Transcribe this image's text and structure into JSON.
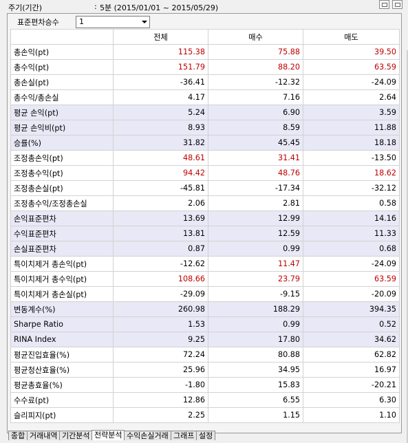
{
  "header": {
    "period_label": "주기(기간)",
    "period_colon": ":",
    "period_value": "5분 (2015/01/01 ~ 2015/05/29)"
  },
  "controls": {
    "std_label": "표준편차승수",
    "std_value": "1"
  },
  "table": {
    "columns": [
      "",
      "전체",
      "매수",
      "매도"
    ],
    "rows": [
      {
        "label": "총손익(pt)",
        "total": "115.38",
        "buy": "75.88",
        "sell": "39.50",
        "hl": false,
        "red": [
          true,
          true,
          true
        ]
      },
      {
        "label": "총수익(pt)",
        "total": "151.79",
        "buy": "88.20",
        "sell": "63.59",
        "hl": false,
        "red": [
          true,
          true,
          true
        ]
      },
      {
        "label": "총손실(pt)",
        "total": "-36.41",
        "buy": "-12.32",
        "sell": "-24.09",
        "hl": false,
        "red": [
          false,
          false,
          false
        ]
      },
      {
        "label": "총수익/총손실",
        "total": "4.17",
        "buy": "7.16",
        "sell": "2.64",
        "hl": false,
        "red": [
          false,
          false,
          false
        ]
      },
      {
        "label": "평균 손익(pt)",
        "total": "5.24",
        "buy": "6.90",
        "sell": "3.59",
        "hl": true,
        "red": [
          false,
          false,
          false
        ]
      },
      {
        "label": "평균 손익비(pt)",
        "total": "8.93",
        "buy": "8.59",
        "sell": "11.88",
        "hl": true,
        "red": [
          false,
          false,
          false
        ]
      },
      {
        "label": "승률(%)",
        "total": "31.82",
        "buy": "45.45",
        "sell": "18.18",
        "hl": true,
        "red": [
          false,
          false,
          false
        ]
      },
      {
        "label": "조정총손익(pt)",
        "total": "48.61",
        "buy": "31.41",
        "sell": "-13.50",
        "hl": false,
        "red": [
          true,
          true,
          false
        ]
      },
      {
        "label": "조정총수익(pt)",
        "total": "94.42",
        "buy": "48.76",
        "sell": "18.62",
        "hl": false,
        "red": [
          true,
          true,
          true
        ]
      },
      {
        "label": "조정총손실(pt)",
        "total": "-45.81",
        "buy": "-17.34",
        "sell": "-32.12",
        "hl": false,
        "red": [
          false,
          false,
          false
        ]
      },
      {
        "label": "조정총수익/조정총손실",
        "total": "2.06",
        "buy": "2.81",
        "sell": "0.58",
        "hl": false,
        "red": [
          false,
          false,
          false
        ]
      },
      {
        "label": "손익표준편차",
        "total": "13.69",
        "buy": "12.99",
        "sell": "14.16",
        "hl": true,
        "red": [
          false,
          false,
          false
        ]
      },
      {
        "label": "수익표준편차",
        "total": "13.81",
        "buy": "12.59",
        "sell": "11.33",
        "hl": true,
        "red": [
          false,
          false,
          false
        ]
      },
      {
        "label": "손실표준편차",
        "total": "0.87",
        "buy": "0.99",
        "sell": "0.68",
        "hl": true,
        "red": [
          false,
          false,
          false
        ]
      },
      {
        "label": "특이치제거 총손익(pt)",
        "total": "-12.62",
        "buy": "11.47",
        "sell": "-24.09",
        "hl": false,
        "red": [
          false,
          true,
          false
        ]
      },
      {
        "label": "특이치제거 총수익(pt)",
        "total": "108.66",
        "buy": "23.79",
        "sell": "63.59",
        "hl": false,
        "red": [
          true,
          true,
          true
        ]
      },
      {
        "label": "특이치제거 총손실(pt)",
        "total": "-29.09",
        "buy": "-9.15",
        "sell": "-20.09",
        "hl": false,
        "red": [
          false,
          false,
          false
        ]
      },
      {
        "label": "변동계수(%)",
        "total": "260.98",
        "buy": "188.29",
        "sell": "394.35",
        "hl": true,
        "red": [
          false,
          false,
          false
        ]
      },
      {
        "label": "Sharpe Ratio",
        "total": "1.53",
        "buy": "0.99",
        "sell": "0.52",
        "hl": true,
        "red": [
          false,
          false,
          false
        ]
      },
      {
        "label": "RINA Index",
        "total": "9.25",
        "buy": "17.80",
        "sell": "34.62",
        "hl": true,
        "red": [
          false,
          false,
          false
        ]
      },
      {
        "label": "평균진입효율(%)",
        "total": "72.24",
        "buy": "80.88",
        "sell": "62.82",
        "hl": false,
        "red": [
          false,
          false,
          false
        ]
      },
      {
        "label": "평균청산효율(%)",
        "total": "25.96",
        "buy": "34.95",
        "sell": "16.97",
        "hl": false,
        "red": [
          false,
          false,
          false
        ]
      },
      {
        "label": "평균총효율(%)",
        "total": "-1.80",
        "buy": "15.83",
        "sell": "-20.21",
        "hl": false,
        "red": [
          false,
          false,
          false
        ]
      },
      {
        "label": "수수료(pt)",
        "total": "12.86",
        "buy": "6.55",
        "sell": "6.30",
        "hl": false,
        "red": [
          false,
          false,
          false
        ]
      },
      {
        "label": "슬리피지(pt)",
        "total": "2.25",
        "buy": "1.15",
        "sell": "1.10",
        "hl": false,
        "red": [
          false,
          false,
          false
        ]
      }
    ]
  },
  "tabs": [
    "종합",
    "거래내역",
    "기간분석",
    "전략분석",
    "수익손실거래",
    "그래프",
    "설정"
  ],
  "active_tab": "전략분석",
  "colors": {
    "positive": "#c00000",
    "highlight_row": "#e8e8f6"
  }
}
